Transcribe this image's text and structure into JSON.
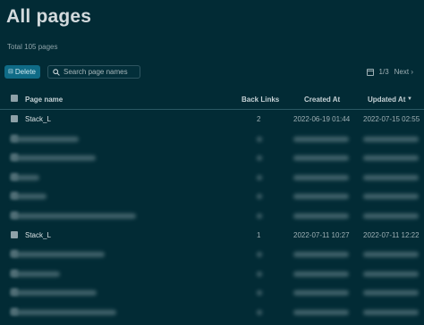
{
  "page": {
    "title": "All pages",
    "total": "Total 105 pages"
  },
  "toolbar": {
    "delete_label": "Delete",
    "delete_icon": "trash-icon",
    "search_placeholder": "Search page names",
    "search_icon": "search-icon",
    "pagination": "1/3",
    "next_label": "Next",
    "next_icon": "chevron-right-icon",
    "calendar_icon": "calendar-icon"
  },
  "table": {
    "columns": [
      "Page name",
      "Back Links",
      "Created At",
      "Updated At"
    ],
    "sort_icon": "caret-down-icon",
    "rows": [
      {
        "name": "Stack_L",
        "back_links": "2",
        "created": "2022-06-19 01:44",
        "updated": "2022-07-15 02:55",
        "blurred": false
      },
      {
        "blurred": true
      },
      {
        "blurred": true
      },
      {
        "blurred": true
      },
      {
        "blurred": true
      },
      {
        "blurred": true
      },
      {
        "name": "Stack_L",
        "back_links": "1",
        "created": "2022-07-11 10:27",
        "updated": "2022-07-11 12:22",
        "blurred": false
      },
      {
        "blurred": true
      },
      {
        "blurred": true
      },
      {
        "blurred": true
      },
      {
        "blurred": true
      }
    ]
  },
  "colors": {
    "background": "#022b35",
    "accent": "#0f6b86",
    "text": "#cfd8dc"
  }
}
